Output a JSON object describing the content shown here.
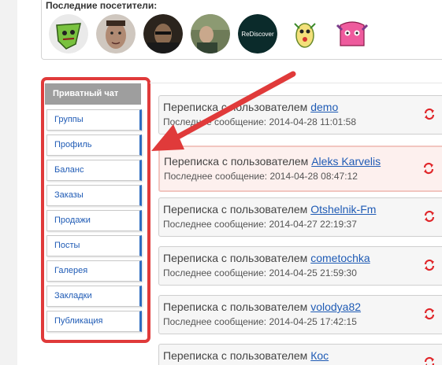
{
  "visitors": {
    "title": "Последние посетители:",
    "avatars": [
      {
        "name": "green-creature-avatar",
        "color": "#79c23f"
      },
      {
        "name": "man-photo-avatar",
        "color": "#9a7a6a"
      },
      {
        "name": "man-dark-photo-avatar",
        "color": "#3b3026"
      },
      {
        "name": "man-room-photo-avatar",
        "color": "#6b7a55"
      },
      {
        "name": "rediscover-logo-avatar",
        "color": "#0b2b2b",
        "label": "ReDiscover"
      },
      {
        "name": "yellow-monster-avatar",
        "color": "#f3e07a"
      },
      {
        "name": "pink-monster-avatar",
        "color": "#ee5b9d"
      }
    ]
  },
  "sidebar": {
    "header": "Приватный чат",
    "items": [
      "Группы",
      "Профиль",
      "Баланс",
      "Заказы",
      "Продажи",
      "Посты",
      "Галерея",
      "Закладки",
      "Публикация"
    ]
  },
  "chats": [
    {
      "prefix": "Переписка с пользователем",
      "user": "demo",
      "meta": "Последнее сообщение: 2014-04-28 11:01:58",
      "highlight": false
    },
    {
      "prefix": "Переписка с пользователем",
      "user": "Aleks Karvelis",
      "meta": "Последнее сообщение: 2014-04-28 08:47:12",
      "highlight": true
    },
    {
      "prefix": "Переписка с пользователем",
      "user": "Otshelnik-Fm",
      "meta": "Последнее сообщение: 2014-04-27 22:19:37",
      "highlight": false
    },
    {
      "prefix": "Переписка с пользователем",
      "user": "cometochka",
      "meta": "Последнее сообщение: 2014-04-25 21:59:30",
      "highlight": false
    },
    {
      "prefix": "Переписка с пользователем",
      "user": "volodya82",
      "meta": "Последнее сообщение: 2014-04-25 17:42:15",
      "highlight": false
    },
    {
      "prefix": "Переписка с пользователем",
      "user": "Кос",
      "meta": "",
      "highlight": false
    }
  ],
  "colors": {
    "accent": "#e03a3a",
    "link": "#1f5bb5",
    "refresh": "#e0262a"
  }
}
